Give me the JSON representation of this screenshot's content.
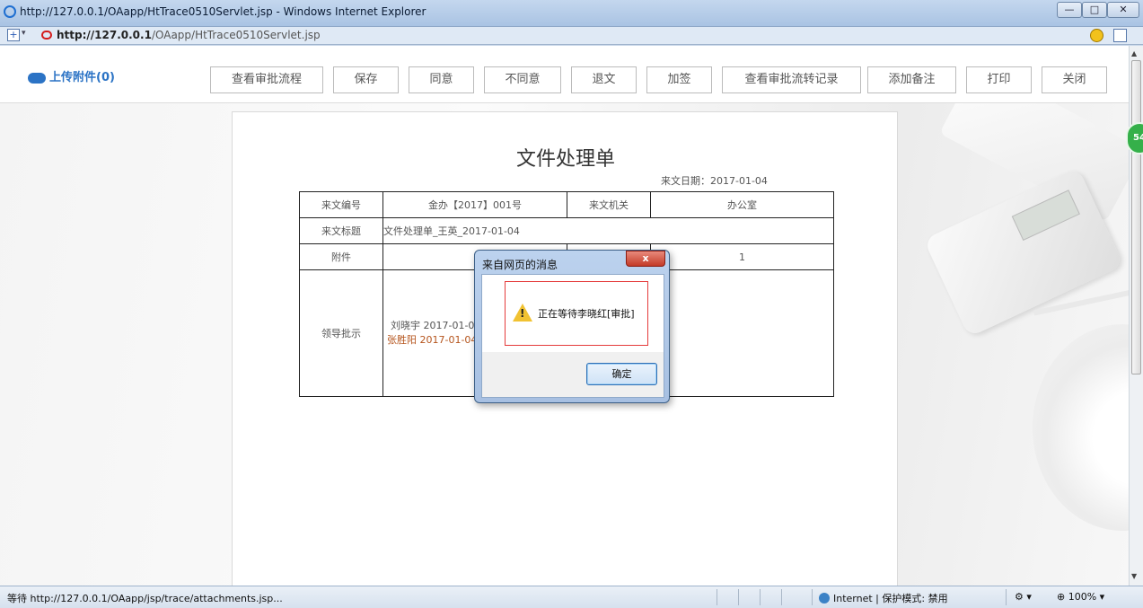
{
  "window": {
    "title": "http://127.0.0.1/OAapp/HtTrace0510Servlet.jsp - Windows Internet Explorer",
    "min_label": "—",
    "max_label": "□",
    "close_label": "✕"
  },
  "address": {
    "url_host": "http://127.0.0.1",
    "url_path": "/OAapp/HtTrace0510Servlet.jsp"
  },
  "toolbar": {
    "upload_label": "上传附件(0)",
    "buttons": [
      {
        "label": "查看审批流程"
      },
      {
        "label": "保存"
      },
      {
        "label": "同意"
      },
      {
        "label": "不同意"
      },
      {
        "label": "退文"
      },
      {
        "label": "加签"
      },
      {
        "label": "查看审批流转记录"
      },
      {
        "label": "添加备注"
      },
      {
        "label": "打印"
      },
      {
        "label": "关闭"
      }
    ]
  },
  "document": {
    "title": "文件处理单",
    "date": "来文日期：2017-01-04",
    "rows": {
      "doc_no_label": "来文编号",
      "doc_no_value": "金办【2017】001号",
      "org_label": "来文机关",
      "org_value": "办公室",
      "subject_label": "来文标题",
      "subject_value": "文件处理单_王英_2017-01-04",
      "attachment_label": "附件",
      "attachment_count": "1",
      "approval_label": "领导批示",
      "approval_1": "刘晓宇 2017-01-04",
      "approval_2": "张胜阳  2017-01-04"
    }
  },
  "dialog": {
    "title": "来自网页的消息",
    "close_label": "x",
    "message": "正在等待李晓红[审批]",
    "ok_label": "确定"
  },
  "side_badge": "54",
  "status": {
    "text": "等待 http://127.0.0.1/OAapp/jsp/trace/attachments.jsp...",
    "zone": "Internet | 保护模式: 禁用",
    "zoom": "100%"
  }
}
